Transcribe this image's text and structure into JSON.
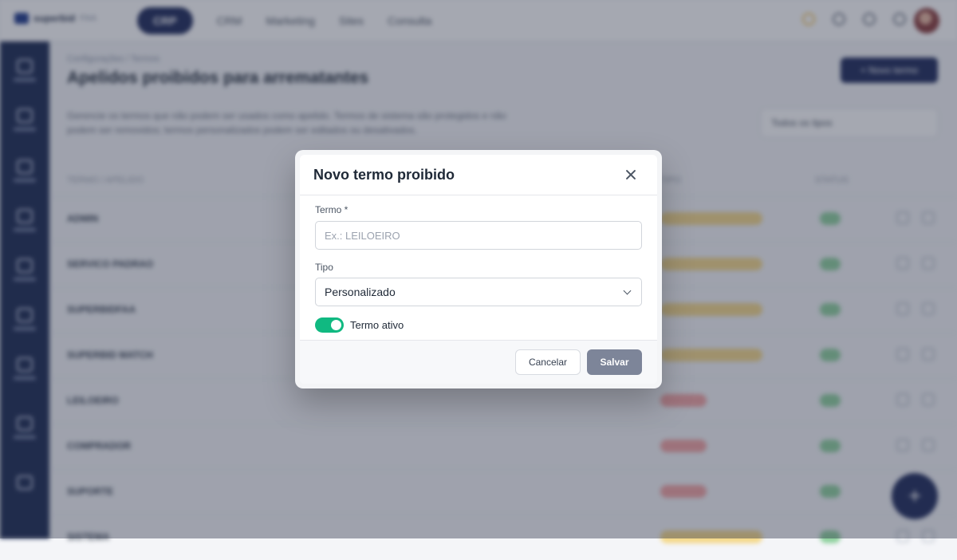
{
  "background": {
    "brand": {
      "name": "superbid",
      "suffix": "FAA"
    },
    "nav": [
      "CRP",
      "CRM",
      "Marketing",
      "Sites",
      "Consulta"
    ],
    "nav_active_index": 0,
    "breadcrumb": "Configurações / Termos",
    "page_title": "Apelidos proibidos para arrematantes",
    "new_button": "+ Novo termo",
    "description": "Gerencie os termos que não podem ser usados como apelido. Termos de sistema são protegidos e não podem ser removidos; termos personalizados podem ser editados ou desativados.",
    "filter_value": "Todos os tipos",
    "table_headers": [
      "TERMO / APELIDO",
      "TIPO",
      "STATUS"
    ],
    "rows": [
      {
        "term": "ADMIN",
        "type": "warn"
      },
      {
        "term": "SERVICO PADRAO",
        "type": "warn"
      },
      {
        "term": "SUPERBIDFAA",
        "type": "warn"
      },
      {
        "term": "SUPERBID MATCH",
        "type": "warn"
      },
      {
        "term": "LEILOEIRO",
        "type": "danger"
      },
      {
        "term": "COMPRADOR",
        "type": "danger"
      },
      {
        "term": "SUPORTE",
        "type": "danger"
      },
      {
        "term": "SISTEMA",
        "type": "warn"
      }
    ],
    "fab_label": "+"
  },
  "modal": {
    "title": "Novo termo proibido",
    "term_label": "Termo *",
    "term_placeholder": "Ex.: LEILOEIRO",
    "term_value": "",
    "type_label": "Tipo",
    "type_value": "Personalizado",
    "active_label": "Termo ativo",
    "active": true,
    "cancel_label": "Cancelar",
    "save_label": "Salvar"
  },
  "colors": {
    "accent_navy": "#1e2a5a",
    "toggle_on": "#10b981",
    "save_disabled": "#7d8599"
  }
}
